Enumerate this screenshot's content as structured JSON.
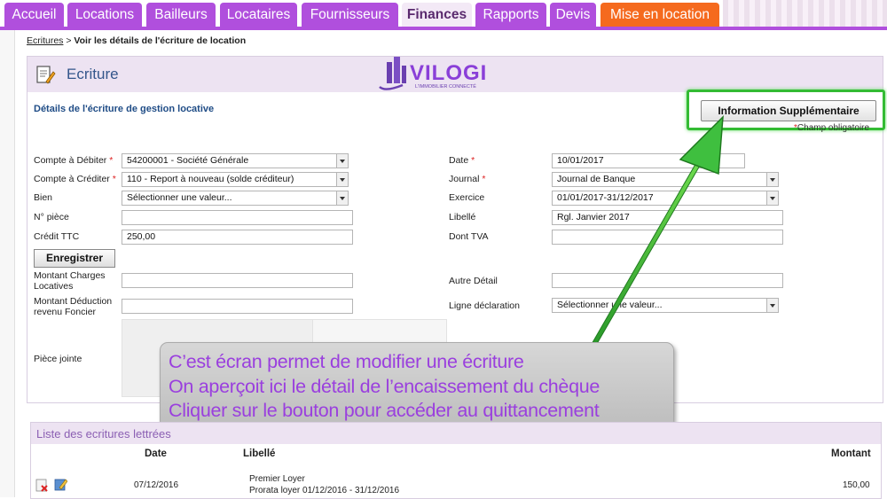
{
  "nav": {
    "tabs": [
      {
        "label": "Accueil",
        "active": false,
        "color": "#b04fdd"
      },
      {
        "label": "Locations",
        "active": false,
        "color": "#b04fdd"
      },
      {
        "label": "Bailleurs",
        "active": false,
        "color": "#b04fdd"
      },
      {
        "label": "Locataires",
        "active": false,
        "color": "#b04fdd"
      },
      {
        "label": "Fournisseurs",
        "active": false,
        "color": "#b04fdd"
      },
      {
        "label": "Finances",
        "active": true,
        "color": "#f3e9f6"
      },
      {
        "label": "Rapports",
        "active": false,
        "color": "#b04fdd"
      },
      {
        "label": "Devis",
        "active": false,
        "color": "#b04fdd"
      },
      {
        "label": "Mise en location",
        "active": false,
        "color": "#f56a1e"
      }
    ]
  },
  "breadcrumb": {
    "link": "Ecritures",
    "separator": " > ",
    "current": "Voir les détails de l'écriture de location"
  },
  "panel": {
    "title": "Ecriture",
    "section_title": "Détails de l'écriture de gestion locative",
    "info_button": "Information Supplémentaire",
    "required_note": "Champ obligatoire",
    "logo": {
      "name": "VILOGI",
      "tagline": "L'IMMOBILIER CONNECTÉ"
    }
  },
  "form": {
    "compte_debiter": {
      "label": "Compte à Débiter",
      "value": "54200001 - Société Générale"
    },
    "compte_crediter": {
      "label": "Compte à Créditer",
      "value": "110 - Report à nouveau (solde créditeur)"
    },
    "bien": {
      "label": "Bien",
      "value": "Sélectionner une valeur..."
    },
    "num_piece": {
      "label": "N° pièce",
      "value": ""
    },
    "credit_ttc": {
      "label": "Crédit TTC",
      "value": "250,00"
    },
    "date": {
      "label": "Date",
      "value": "10/01/2017"
    },
    "journal": {
      "label": "Journal",
      "value": "Journal de Banque"
    },
    "exercice": {
      "label": "Exercice",
      "value": "01/01/2017-31/12/2017"
    },
    "libelle": {
      "label": "Libellé",
      "value": "Rgl. Janvier 2017"
    },
    "dont_tva": {
      "label": "Dont TVA",
      "value": ""
    },
    "save_button": "Enregistrer",
    "montant_charges": {
      "label_line1": "Montant Charges",
      "label_line2": "Locatives",
      "value": ""
    },
    "montant_deduction": {
      "label_line1": "Montant Déduction",
      "label_line2": "revenu Foncier",
      "value": ""
    },
    "autre_detail": {
      "label": "Autre Détail",
      "value": ""
    },
    "ligne_declaration": {
      "label": "Ligne déclaration",
      "value": "Sélectionner une valeur..."
    },
    "piece_jointe": {
      "label": "Pièce jointe"
    }
  },
  "callout": {
    "lines": [
      "C’est écran permet de modifier une écriture",
      "On aperçoit ici le détail de l’encaissement du chèque",
      "Cliquer sur le bouton pour accéder au quittancement"
    ]
  },
  "list": {
    "title": "Liste des ecritures lettrées",
    "columns": {
      "date": "Date",
      "libelle": "Libellé",
      "montant": "Montant"
    },
    "rows": [
      {
        "date": "07/12/2016",
        "libelle_line1": "Premier Loyer",
        "libelle_line2": "Prorata loyer 01/12/2016 - 31/12/2016",
        "montant": "150,00"
      }
    ]
  },
  "colors": {
    "nav_purple": "#b04fdd",
    "nav_orange": "#f56a1e",
    "highlight_green": "#33bb33",
    "callout_text": "#9a3fde",
    "title_blue": "#34568b"
  }
}
